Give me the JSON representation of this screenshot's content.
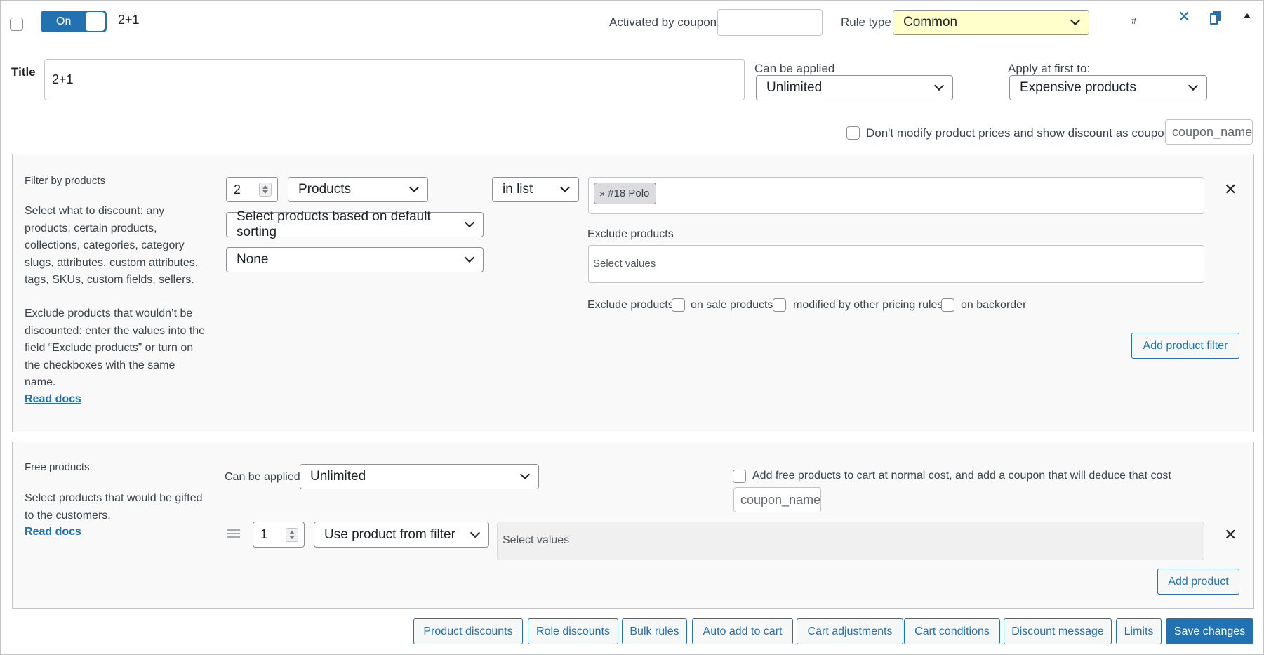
{
  "header": {
    "toggle_label": "On",
    "rule_name": "2+1",
    "activated_by_coupon_label": "Activated by coupon",
    "activated_by_coupon_value": "",
    "rule_type_label": "Rule type",
    "rule_type_value": "Common",
    "hash_label": "#"
  },
  "title_row": {
    "title_label": "Title",
    "title_value": "2+1",
    "can_be_applied_label": "Can be applied",
    "can_be_applied_value": "Unlimited",
    "apply_first_label": "Apply at first to:",
    "apply_first_value": "Expensive products",
    "dont_modify_label": "Don't modify product prices and show discount as coupon",
    "coupon_placeholder": "coupon_name"
  },
  "filter_panel": {
    "heading": "Filter by products",
    "desc1": "Select what to discount: any products, certain products, collections, categories, category slugs, attributes, custom attributes, tags, SKUs, custom fields, sellers.",
    "desc2": "Exclude products that wouldn’t be discounted: enter the values into the field “Exclude products” or turn on the checkboxes with the same name.",
    "read_docs": "Read docs",
    "qty_value": "2",
    "type_value": "Products",
    "condition_value": "in list",
    "tag_label": "#18 Polo",
    "tag_remove": "×",
    "sorting_value": "Select products based on default sorting",
    "none_value": "None",
    "exclude_label": "Exclude products",
    "exclude_placeholder": "Select values",
    "exclude_checks_label": "Exclude products",
    "on_sale_label": "on sale products",
    "modified_label": "modified by other pricing rules",
    "backorder_label": "on backorder",
    "add_filter_label": "Add product filter"
  },
  "free_panel": {
    "heading": "Free products.",
    "desc": "Select products that would be gifted to the customers.",
    "read_docs": "Read docs",
    "can_be_applied_label": "Can be applied",
    "can_be_applied_value": "Unlimited",
    "add_free_label": "Add free products to cart at normal cost, and add a coupon that will deduce that cost",
    "coupon_placeholder": "coupon_name",
    "qty_value": "1",
    "product_source_value": "Use product from filter",
    "values_placeholder": "Select values",
    "add_product_label": "Add product"
  },
  "footer": {
    "buttons": [
      "Product discounts",
      "Role discounts",
      "Bulk rules",
      "Auto add to cart",
      "Cart adjustments",
      "Cart conditions",
      "Discount message",
      "Limits"
    ],
    "save_label": "Save changes"
  },
  "colors": {
    "accent": "#2271b1",
    "rule_type_bg": "#ffffcc"
  }
}
